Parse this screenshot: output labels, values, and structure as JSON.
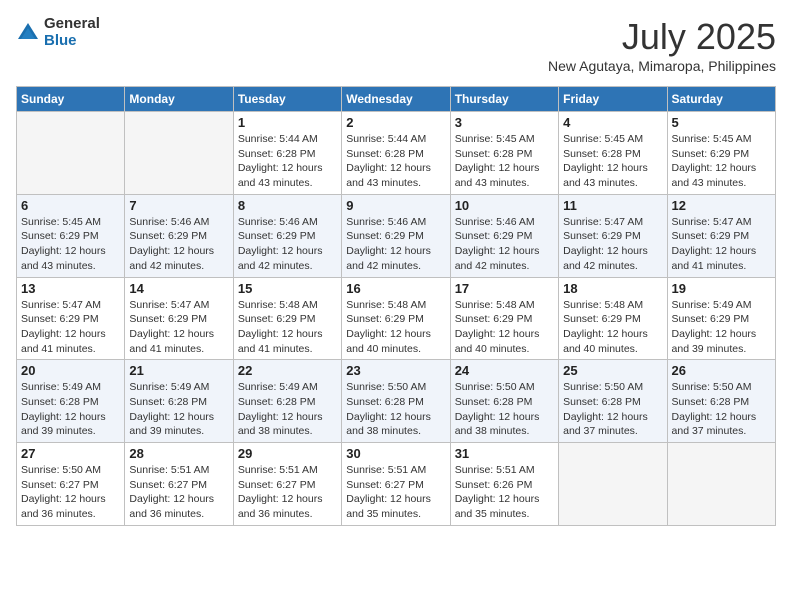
{
  "header": {
    "logo_general": "General",
    "logo_blue": "Blue",
    "month_title": "July 2025",
    "location": "New Agutaya, Mimaropa, Philippines"
  },
  "weekdays": [
    "Sunday",
    "Monday",
    "Tuesday",
    "Wednesday",
    "Thursday",
    "Friday",
    "Saturday"
  ],
  "weeks": [
    [
      {
        "day": "",
        "info": ""
      },
      {
        "day": "",
        "info": ""
      },
      {
        "day": "1",
        "info": "Sunrise: 5:44 AM\nSunset: 6:28 PM\nDaylight: 12 hours and 43 minutes."
      },
      {
        "day": "2",
        "info": "Sunrise: 5:44 AM\nSunset: 6:28 PM\nDaylight: 12 hours and 43 minutes."
      },
      {
        "day": "3",
        "info": "Sunrise: 5:45 AM\nSunset: 6:28 PM\nDaylight: 12 hours and 43 minutes."
      },
      {
        "day": "4",
        "info": "Sunrise: 5:45 AM\nSunset: 6:28 PM\nDaylight: 12 hours and 43 minutes."
      },
      {
        "day": "5",
        "info": "Sunrise: 5:45 AM\nSunset: 6:29 PM\nDaylight: 12 hours and 43 minutes."
      }
    ],
    [
      {
        "day": "6",
        "info": "Sunrise: 5:45 AM\nSunset: 6:29 PM\nDaylight: 12 hours and 43 minutes."
      },
      {
        "day": "7",
        "info": "Sunrise: 5:46 AM\nSunset: 6:29 PM\nDaylight: 12 hours and 42 minutes."
      },
      {
        "day": "8",
        "info": "Sunrise: 5:46 AM\nSunset: 6:29 PM\nDaylight: 12 hours and 42 minutes."
      },
      {
        "day": "9",
        "info": "Sunrise: 5:46 AM\nSunset: 6:29 PM\nDaylight: 12 hours and 42 minutes."
      },
      {
        "day": "10",
        "info": "Sunrise: 5:46 AM\nSunset: 6:29 PM\nDaylight: 12 hours and 42 minutes."
      },
      {
        "day": "11",
        "info": "Sunrise: 5:47 AM\nSunset: 6:29 PM\nDaylight: 12 hours and 42 minutes."
      },
      {
        "day": "12",
        "info": "Sunrise: 5:47 AM\nSunset: 6:29 PM\nDaylight: 12 hours and 41 minutes."
      }
    ],
    [
      {
        "day": "13",
        "info": "Sunrise: 5:47 AM\nSunset: 6:29 PM\nDaylight: 12 hours and 41 minutes."
      },
      {
        "day": "14",
        "info": "Sunrise: 5:47 AM\nSunset: 6:29 PM\nDaylight: 12 hours and 41 minutes."
      },
      {
        "day": "15",
        "info": "Sunrise: 5:48 AM\nSunset: 6:29 PM\nDaylight: 12 hours and 41 minutes."
      },
      {
        "day": "16",
        "info": "Sunrise: 5:48 AM\nSunset: 6:29 PM\nDaylight: 12 hours and 40 minutes."
      },
      {
        "day": "17",
        "info": "Sunrise: 5:48 AM\nSunset: 6:29 PM\nDaylight: 12 hours and 40 minutes."
      },
      {
        "day": "18",
        "info": "Sunrise: 5:48 AM\nSunset: 6:29 PM\nDaylight: 12 hours and 40 minutes."
      },
      {
        "day": "19",
        "info": "Sunrise: 5:49 AM\nSunset: 6:29 PM\nDaylight: 12 hours and 39 minutes."
      }
    ],
    [
      {
        "day": "20",
        "info": "Sunrise: 5:49 AM\nSunset: 6:28 PM\nDaylight: 12 hours and 39 minutes."
      },
      {
        "day": "21",
        "info": "Sunrise: 5:49 AM\nSunset: 6:28 PM\nDaylight: 12 hours and 39 minutes."
      },
      {
        "day": "22",
        "info": "Sunrise: 5:49 AM\nSunset: 6:28 PM\nDaylight: 12 hours and 38 minutes."
      },
      {
        "day": "23",
        "info": "Sunrise: 5:50 AM\nSunset: 6:28 PM\nDaylight: 12 hours and 38 minutes."
      },
      {
        "day": "24",
        "info": "Sunrise: 5:50 AM\nSunset: 6:28 PM\nDaylight: 12 hours and 38 minutes."
      },
      {
        "day": "25",
        "info": "Sunrise: 5:50 AM\nSunset: 6:28 PM\nDaylight: 12 hours and 37 minutes."
      },
      {
        "day": "26",
        "info": "Sunrise: 5:50 AM\nSunset: 6:28 PM\nDaylight: 12 hours and 37 minutes."
      }
    ],
    [
      {
        "day": "27",
        "info": "Sunrise: 5:50 AM\nSunset: 6:27 PM\nDaylight: 12 hours and 36 minutes."
      },
      {
        "day": "28",
        "info": "Sunrise: 5:51 AM\nSunset: 6:27 PM\nDaylight: 12 hours and 36 minutes."
      },
      {
        "day": "29",
        "info": "Sunrise: 5:51 AM\nSunset: 6:27 PM\nDaylight: 12 hours and 36 minutes."
      },
      {
        "day": "30",
        "info": "Sunrise: 5:51 AM\nSunset: 6:27 PM\nDaylight: 12 hours and 35 minutes."
      },
      {
        "day": "31",
        "info": "Sunrise: 5:51 AM\nSunset: 6:26 PM\nDaylight: 12 hours and 35 minutes."
      },
      {
        "day": "",
        "info": ""
      },
      {
        "day": "",
        "info": ""
      }
    ]
  ]
}
